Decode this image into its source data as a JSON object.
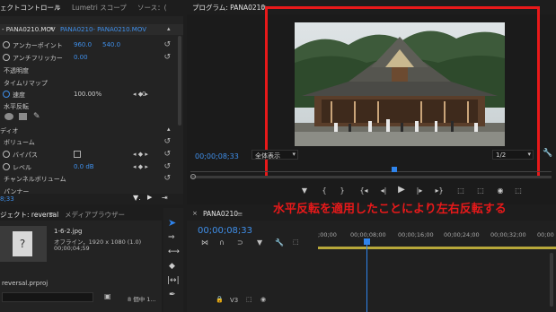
{
  "effect_controls": {
    "tab_label": "ェクトコントロール",
    "tab_menu": "≡",
    "lumetri_label": "Lumetri スコープ",
    "source_label": "ソース：(",
    "clip_source": "- PANA0210.MOV",
    "clip_seq": "PANA0210- PANA0210.MOV",
    "rows": {
      "anchor": {
        "label": "アンカーポイント",
        "x": "960.0",
        "y": "540.0"
      },
      "antiflicker": {
        "label": "アンチフリッカー",
        "value": "0.00"
      },
      "opacity": {
        "label": "不透明度"
      },
      "time_remap": {
        "label": "タイムリマップ"
      },
      "speed": {
        "label": "速度",
        "value": "100.00%"
      },
      "hflip": {
        "label": "水平反転"
      },
      "audio": {
        "label": "ディオ"
      },
      "volume": {
        "label": "ボリューム"
      },
      "bypass": {
        "label": "バイパス"
      },
      "level": {
        "label": "レベル",
        "value": "0.0 dB"
      },
      "channel_volume": {
        "label": "チャンネルボリューム"
      },
      "panner": {
        "label": "パンナー"
      }
    },
    "timecode": "8;33",
    "keyframe_zero": "0"
  },
  "program": {
    "tab_label": "プログラム: PANA0210",
    "tab_menu": "≡",
    "timecode": "00;00;08;33",
    "zoom_label": "全体表示",
    "quality_label": "1/2",
    "annotation": "水平反転を適用したことにより左右反転する"
  },
  "project": {
    "tab_label": "ジェクト: reversal",
    "tab_menu": "≡",
    "media_browser": "メディアブラウザー",
    "clip_name": "1-6-2.jpg",
    "clip_meta": "オフライン，1920 x 1080 (1.0)",
    "clip_duration": "00;00;04;59",
    "project_file": "reversal.prproj",
    "item_count": "8 個中 1..."
  },
  "timeline": {
    "tab_label": "PANA0210",
    "tab_menu": "≡",
    "timecode": "00;00;08;33",
    "ruler": [
      ";00;00",
      "00;00;08;00",
      "00;00;16;00",
      "00;00;24;00",
      "00;00;32;00",
      "00;00"
    ],
    "track_v3": "V3"
  },
  "colors": {
    "accent_blue": "#2f84ec",
    "annotation_red": "#e8191a"
  }
}
